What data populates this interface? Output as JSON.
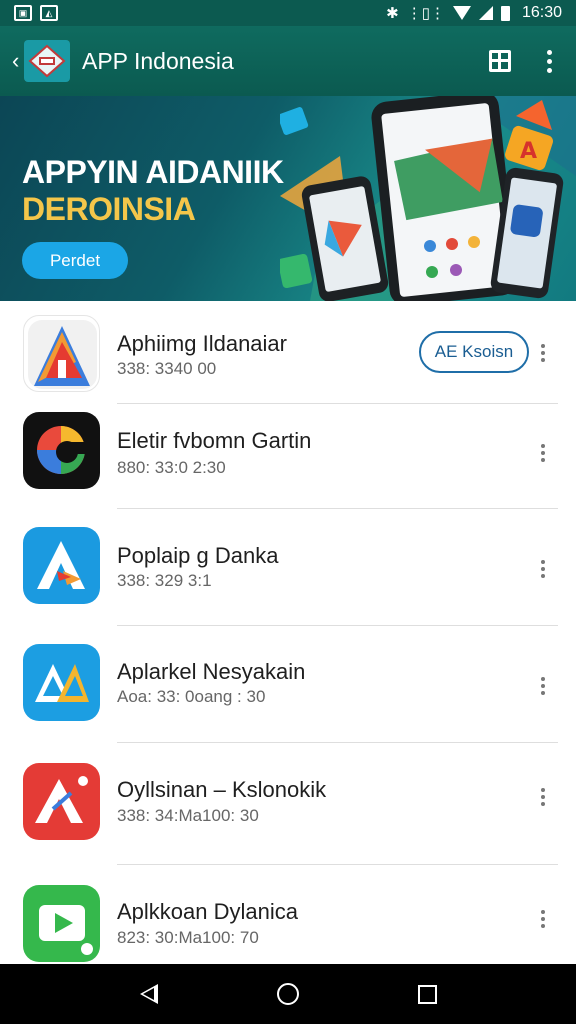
{
  "status_bar": {
    "time": "16:30",
    "left_icons": [
      "gallery-icon",
      "image-icon"
    ],
    "right_icons": [
      "bluetooth-icon",
      "vibrate-icon",
      "wifi-icon",
      "signal-icon",
      "battery-icon"
    ]
  },
  "app_bar": {
    "title": "APP Indonesia",
    "actions": [
      "grid-icon",
      "more-vert-icon"
    ]
  },
  "banner": {
    "line1": "APPYIN AIDANIIK",
    "line2": "DEROINSIA",
    "button": "Perdet"
  },
  "apps": [
    {
      "name": "Aphiimg Ildanaiar",
      "meta": "338: 3340 00",
      "icon": "app-icon-red-a",
      "action": "AE Ksoisn"
    },
    {
      "name": "Eletir fvbomn Gartin",
      "meta": "880: 33:0 2:30",
      "icon": "app-icon-multicolor"
    },
    {
      "name": "Poplaip g Danka",
      "meta": "338: 329 3:1",
      "icon": "app-icon-blue-a"
    },
    {
      "name": "Aplarkel Nesyakain",
      "meta": "Aoa: 33: 0oang : 30",
      "icon": "app-icon-blue-yellow-a"
    },
    {
      "name": "Oyllsinan – Kslonokik",
      "meta": "338: 34:Ma100: 30",
      "icon": "app-icon-red-white-a"
    },
    {
      "name": "Aplkkoan Dylanica",
      "meta": "823: 30:Ma100: 70",
      "icon": "app-icon-green-play"
    }
  ],
  "colors": {
    "app_bar": "#0f6b5f",
    "accent_button": "#1ba6e6",
    "banner_highlight": "#f4c64a"
  }
}
